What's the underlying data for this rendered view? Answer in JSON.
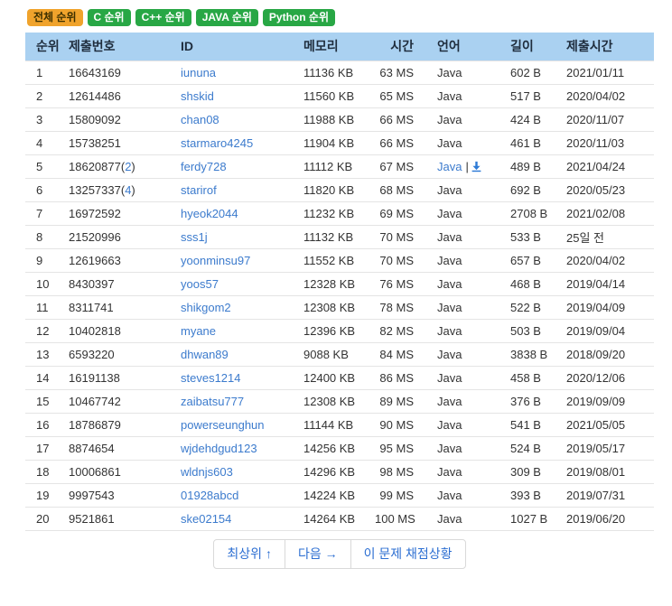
{
  "colors": {
    "tab_active_bg": "#f0a32c",
    "tab_active_text": "#3d3000",
    "tab_bg": "#28a745",
    "tab_text": "#ffffff",
    "header_bg": "#aad1f1",
    "header_text": "#1f2d3d",
    "text": "#333333",
    "link": "#3c7bcd",
    "icon_blue": "#2e7bd6",
    "row_border": "#e4e4e4",
    "btn_text": "#2d6fd2",
    "btn_border": "#d9d9d9"
  },
  "tabs": [
    {
      "label": "전체 순위",
      "active": true
    },
    {
      "label": "C 순위",
      "active": false
    },
    {
      "label": "C++ 순위",
      "active": false
    },
    {
      "label": "JAVA 순위",
      "active": false
    },
    {
      "label": "Python 순위",
      "active": false
    }
  ],
  "table": {
    "headers": [
      "순위",
      "제출번호",
      "ID",
      "메모리",
      "시간",
      "언어",
      "길이",
      "제출시간"
    ],
    "rows": [
      {
        "rank": "1",
        "submission": "16643169",
        "retry": "",
        "id": "iununa",
        "memory": "11136 KB",
        "time": "63 MS",
        "language": "Java",
        "code_link": false,
        "length": "602 B",
        "submitted": "2021/01/11"
      },
      {
        "rank": "2",
        "submission": "12614486",
        "retry": "",
        "id": "shskid",
        "memory": "11560 KB",
        "time": "65 MS",
        "language": "Java",
        "code_link": false,
        "length": "517 B",
        "submitted": "2020/04/02"
      },
      {
        "rank": "3",
        "submission": "15809092",
        "retry": "",
        "id": "chan08",
        "memory": "11988 KB",
        "time": "66 MS",
        "language": "Java",
        "code_link": false,
        "length": "424 B",
        "submitted": "2020/11/07"
      },
      {
        "rank": "4",
        "submission": "15738251",
        "retry": "",
        "id": "starmaro4245",
        "memory": "11904 KB",
        "time": "66 MS",
        "language": "Java",
        "code_link": false,
        "length": "461 B",
        "submitted": "2020/11/03"
      },
      {
        "rank": "5",
        "submission": "18620877",
        "retry": "2",
        "id": "ferdy728",
        "memory": "11112 KB",
        "time": "67 MS",
        "language": "Java",
        "code_link": true,
        "length": "489 B",
        "submitted": "2021/04/24"
      },
      {
        "rank": "6",
        "submission": "13257337",
        "retry": "4",
        "id": "starirof",
        "memory": "11820 KB",
        "time": "68 MS",
        "language": "Java",
        "code_link": false,
        "length": "692 B",
        "submitted": "2020/05/23"
      },
      {
        "rank": "7",
        "submission": "16972592",
        "retry": "",
        "id": "hyeok2044",
        "memory": "11232 KB",
        "time": "69 MS",
        "language": "Java",
        "code_link": false,
        "length": "2708 B",
        "submitted": "2021/02/08"
      },
      {
        "rank": "8",
        "submission": "21520996",
        "retry": "",
        "id": "sss1j",
        "memory": "11132 KB",
        "time": "70 MS",
        "language": "Java",
        "code_link": false,
        "length": "533 B",
        "submitted": "25일 전"
      },
      {
        "rank": "9",
        "submission": "12619663",
        "retry": "",
        "id": "yoonminsu97",
        "memory": "11552 KB",
        "time": "70 MS",
        "language": "Java",
        "code_link": false,
        "length": "657 B",
        "submitted": "2020/04/02"
      },
      {
        "rank": "10",
        "submission": "8430397",
        "retry": "",
        "id": "yoos57",
        "memory": "12328 KB",
        "time": "76 MS",
        "language": "Java",
        "code_link": false,
        "length": "468 B",
        "submitted": "2019/04/14"
      },
      {
        "rank": "11",
        "submission": "8311741",
        "retry": "",
        "id": "shikgom2",
        "memory": "12308 KB",
        "time": "78 MS",
        "language": "Java",
        "code_link": false,
        "length": "522 B",
        "submitted": "2019/04/09"
      },
      {
        "rank": "12",
        "submission": "10402818",
        "retry": "",
        "id": "myane",
        "memory": "12396 KB",
        "time": "82 MS",
        "language": "Java",
        "code_link": false,
        "length": "503 B",
        "submitted": "2019/09/04"
      },
      {
        "rank": "13",
        "submission": "6593220",
        "retry": "",
        "id": "dhwan89",
        "memory": "9088 KB",
        "time": "84 MS",
        "language": "Java",
        "code_link": false,
        "length": "3838 B",
        "submitted": "2018/09/20"
      },
      {
        "rank": "14",
        "submission": "16191138",
        "retry": "",
        "id": "steves1214",
        "memory": "12400 KB",
        "time": "86 MS",
        "language": "Java",
        "code_link": false,
        "length": "458 B",
        "submitted": "2020/12/06"
      },
      {
        "rank": "15",
        "submission": "10467742",
        "retry": "",
        "id": "zaibatsu777",
        "memory": "12308 KB",
        "time": "89 MS",
        "language": "Java",
        "code_link": false,
        "length": "376 B",
        "submitted": "2019/09/09"
      },
      {
        "rank": "16",
        "submission": "18786879",
        "retry": "",
        "id": "powerseunghun",
        "memory": "11144 KB",
        "time": "90 MS",
        "language": "Java",
        "code_link": false,
        "length": "541 B",
        "submitted": "2021/05/05"
      },
      {
        "rank": "17",
        "submission": "8874654",
        "retry": "",
        "id": "wjdehdgud123",
        "memory": "14256 KB",
        "time": "95 MS",
        "language": "Java",
        "code_link": false,
        "length": "524 B",
        "submitted": "2019/05/17"
      },
      {
        "rank": "18",
        "submission": "10006861",
        "retry": "",
        "id": "wldnjs603",
        "memory": "14296 KB",
        "time": "98 MS",
        "language": "Java",
        "code_link": false,
        "length": "309 B",
        "submitted": "2019/08/01"
      },
      {
        "rank": "19",
        "submission": "9997543",
        "retry": "",
        "id": "01928abcd",
        "memory": "14224 KB",
        "time": "99 MS",
        "language": "Java",
        "code_link": false,
        "length": "393 B",
        "submitted": "2019/07/31"
      },
      {
        "rank": "20",
        "submission": "9521861",
        "retry": "",
        "id": "ske02154",
        "memory": "14264 KB",
        "time": "100 MS",
        "language": "Java",
        "code_link": false,
        "length": "1027 B",
        "submitted": "2019/06/20"
      }
    ]
  },
  "footer": {
    "buttons": [
      "최상위 ↑",
      "다음 →",
      "이 문제 채점상황"
    ]
  }
}
